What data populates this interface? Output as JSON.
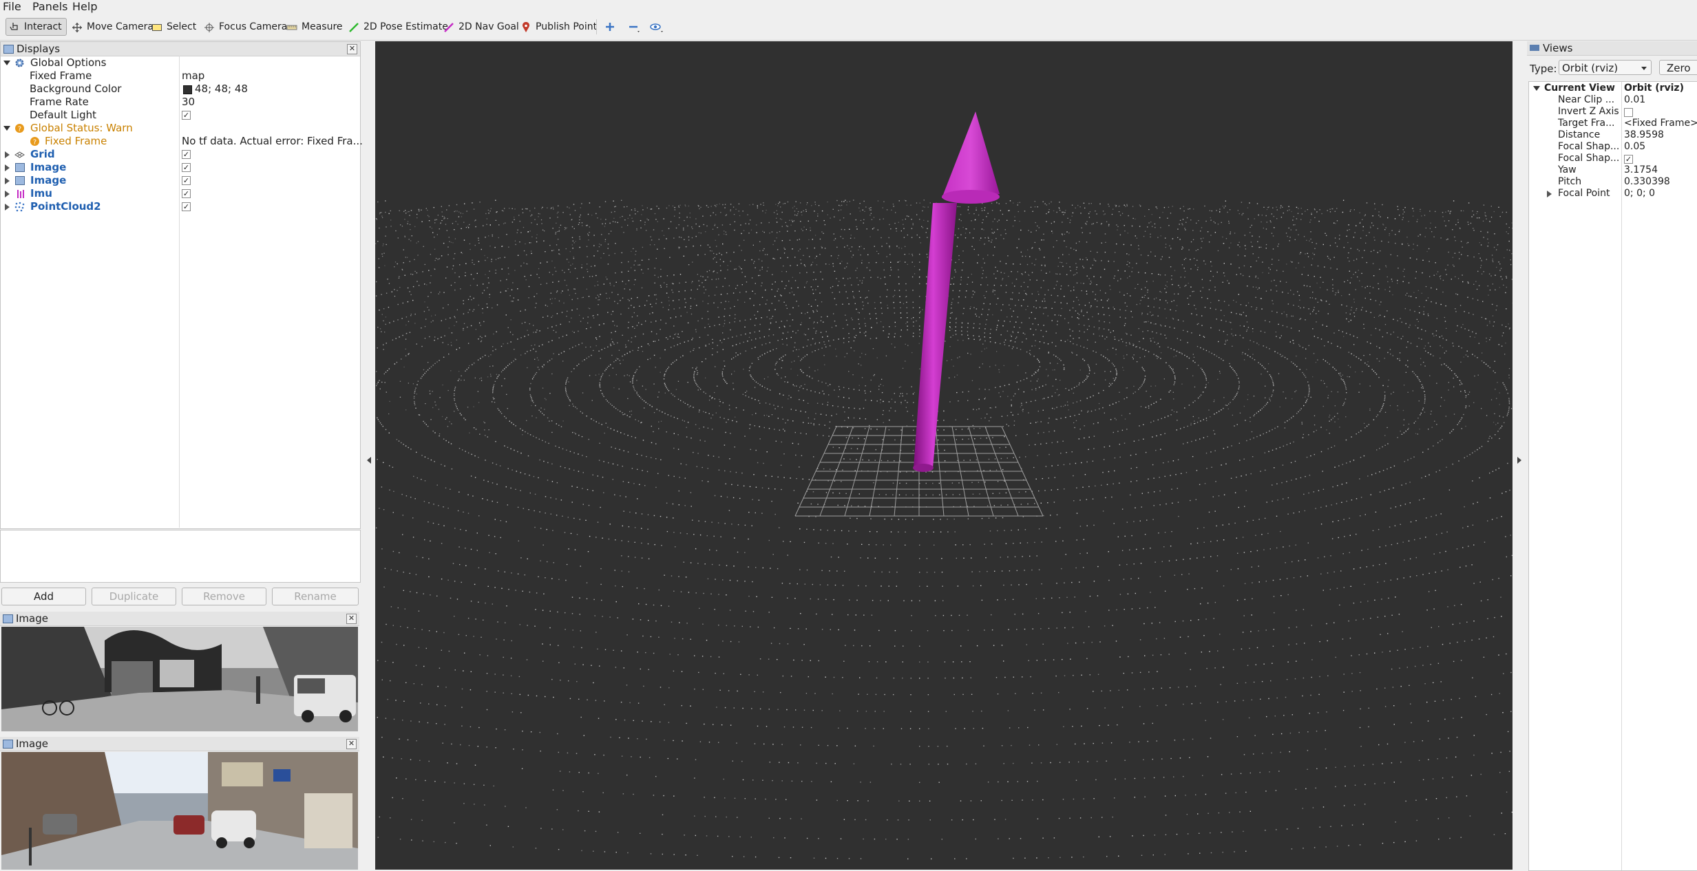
{
  "menu": {
    "file": "File",
    "panels": "Panels",
    "help": "Help"
  },
  "toolbar": {
    "interact": "Interact",
    "move_camera": "Move Camera",
    "select": "Select",
    "focus_camera": "Focus Camera",
    "measure": "Measure",
    "pose_estimate": "2D Pose Estimate",
    "nav_goal": "2D Nav Goal",
    "publish_point": "Publish Point"
  },
  "displays": {
    "title": "Displays",
    "global_options": {
      "label": "Global Options",
      "fixed_frame_label": "Fixed Frame",
      "fixed_frame_value": "map",
      "bg_color_label": "Background Color",
      "bg_color_value": "48; 48; 48",
      "bg_color_swatch": "#303030",
      "frame_rate_label": "Frame Rate",
      "frame_rate_value": "30",
      "default_light_label": "Default Light",
      "default_light_checked": true
    },
    "global_status": {
      "label": "Global Status: Warn",
      "fixed_frame_label": "Fixed Frame",
      "fixed_frame_value": "No tf data.  Actual error: Fixed Fra..."
    },
    "items": [
      {
        "label": "Grid",
        "checked": true
      },
      {
        "label": "Image",
        "checked": true
      },
      {
        "label": "Image",
        "checked": true
      },
      {
        "label": "Imu",
        "checked": true
      },
      {
        "label": "PointCloud2",
        "checked": true
      }
    ],
    "buttons": {
      "add": "Add",
      "duplicate": "Duplicate",
      "remove": "Remove",
      "rename": "Rename"
    }
  },
  "image_panel_1": {
    "title": "Image"
  },
  "image_panel_2": {
    "title": "Image"
  },
  "views": {
    "title": "Views",
    "type_label": "Type:",
    "type_value": "Orbit (rviz)",
    "zero_button": "Zero",
    "current_view_label": "Current View",
    "current_view_value": "Orbit (rviz)",
    "props": [
      {
        "label": "Near Clip ...",
        "value": "0.01"
      },
      {
        "label": "Invert Z Axis",
        "value": ""
      },
      {
        "label": "Target Fra...",
        "value": "<Fixed Frame>"
      },
      {
        "label": "Distance",
        "value": "38.9598"
      },
      {
        "label": "Focal Shap...",
        "value": "0.05"
      },
      {
        "label": "Focal Shap...",
        "value": ""
      },
      {
        "label": "Yaw",
        "value": "3.1754"
      },
      {
        "label": "Pitch",
        "value": "0.330398"
      },
      {
        "label": "Focal Point",
        "value": "0; 0; 0"
      }
    ]
  },
  "colors": {
    "arrow": "#b722b5",
    "pointcloud": "#d9d9d9",
    "viewport_bg": "#303030",
    "grid": "#a0a0a0"
  }
}
